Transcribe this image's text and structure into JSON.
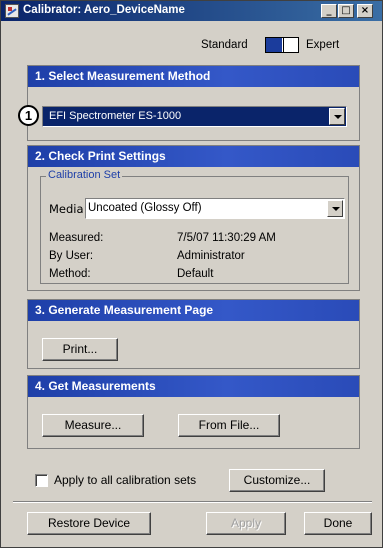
{
  "window": {
    "title": "Calibrator: Aero_DeviceName",
    "minimize": "_",
    "maximize": "□",
    "close": "×"
  },
  "mode": {
    "standard_label": "Standard",
    "expert_label": "Expert",
    "selected": "Standard"
  },
  "section1": {
    "header": "1. Select Measurement Method",
    "method_value": "EFI Spectrometer ES-1000",
    "callout": "1"
  },
  "section2": {
    "header": "2. Check Print Settings",
    "group_title": "Calibration Set",
    "media_label": "Media",
    "media_value": "Uncoated (Glossy Off)",
    "measured_label": "Measured:",
    "measured_value": "7/5/07 11:30:29 AM",
    "user_label": "By User:",
    "user_value": "Administrator",
    "method_label": "Method:",
    "method_value": "Default"
  },
  "section3": {
    "header": "3. Generate Measurement Page",
    "print_label": "Print..."
  },
  "section4": {
    "header": "4. Get Measurements",
    "measure_label": "Measure...",
    "fromfile_label": "From File..."
  },
  "footer": {
    "apply_all_label": "Apply to all calibration sets",
    "apply_all_checked": false,
    "customize_label": "Customize...",
    "restore_label": "Restore Device",
    "apply_label": "Apply",
    "done_label": "Done"
  }
}
